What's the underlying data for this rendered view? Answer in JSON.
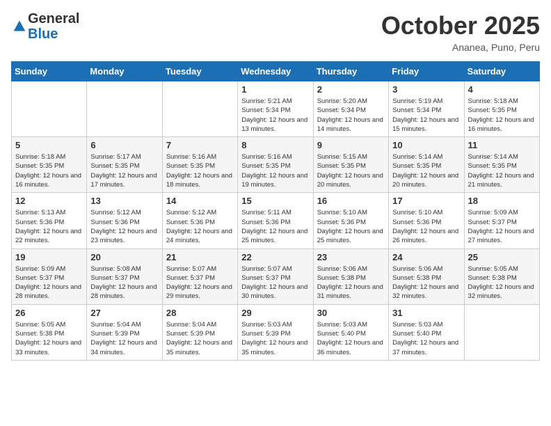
{
  "logo": {
    "general": "General",
    "blue": "Blue"
  },
  "header": {
    "month_title": "October 2025",
    "location": "Ananea, Puno, Peru"
  },
  "weekdays": [
    "Sunday",
    "Monday",
    "Tuesday",
    "Wednesday",
    "Thursday",
    "Friday",
    "Saturday"
  ],
  "weeks": [
    [
      {
        "day": "",
        "info": ""
      },
      {
        "day": "",
        "info": ""
      },
      {
        "day": "",
        "info": ""
      },
      {
        "day": "1",
        "info": "Sunrise: 5:21 AM\nSunset: 5:34 PM\nDaylight: 12 hours and 13 minutes."
      },
      {
        "day": "2",
        "info": "Sunrise: 5:20 AM\nSunset: 5:34 PM\nDaylight: 12 hours and 14 minutes."
      },
      {
        "day": "3",
        "info": "Sunrise: 5:19 AM\nSunset: 5:34 PM\nDaylight: 12 hours and 15 minutes."
      },
      {
        "day": "4",
        "info": "Sunrise: 5:18 AM\nSunset: 5:35 PM\nDaylight: 12 hours and 16 minutes."
      }
    ],
    [
      {
        "day": "5",
        "info": "Sunrise: 5:18 AM\nSunset: 5:35 PM\nDaylight: 12 hours and 16 minutes."
      },
      {
        "day": "6",
        "info": "Sunrise: 5:17 AM\nSunset: 5:35 PM\nDaylight: 12 hours and 17 minutes."
      },
      {
        "day": "7",
        "info": "Sunrise: 5:16 AM\nSunset: 5:35 PM\nDaylight: 12 hours and 18 minutes."
      },
      {
        "day": "8",
        "info": "Sunrise: 5:16 AM\nSunset: 5:35 PM\nDaylight: 12 hours and 19 minutes."
      },
      {
        "day": "9",
        "info": "Sunrise: 5:15 AM\nSunset: 5:35 PM\nDaylight: 12 hours and 20 minutes."
      },
      {
        "day": "10",
        "info": "Sunrise: 5:14 AM\nSunset: 5:35 PM\nDaylight: 12 hours and 20 minutes."
      },
      {
        "day": "11",
        "info": "Sunrise: 5:14 AM\nSunset: 5:35 PM\nDaylight: 12 hours and 21 minutes."
      }
    ],
    [
      {
        "day": "12",
        "info": "Sunrise: 5:13 AM\nSunset: 5:36 PM\nDaylight: 12 hours and 22 minutes."
      },
      {
        "day": "13",
        "info": "Sunrise: 5:12 AM\nSunset: 5:36 PM\nDaylight: 12 hours and 23 minutes."
      },
      {
        "day": "14",
        "info": "Sunrise: 5:12 AM\nSunset: 5:36 PM\nDaylight: 12 hours and 24 minutes."
      },
      {
        "day": "15",
        "info": "Sunrise: 5:11 AM\nSunset: 5:36 PM\nDaylight: 12 hours and 25 minutes."
      },
      {
        "day": "16",
        "info": "Sunrise: 5:10 AM\nSunset: 5:36 PM\nDaylight: 12 hours and 25 minutes."
      },
      {
        "day": "17",
        "info": "Sunrise: 5:10 AM\nSunset: 5:36 PM\nDaylight: 12 hours and 26 minutes."
      },
      {
        "day": "18",
        "info": "Sunrise: 5:09 AM\nSunset: 5:37 PM\nDaylight: 12 hours and 27 minutes."
      }
    ],
    [
      {
        "day": "19",
        "info": "Sunrise: 5:09 AM\nSunset: 5:37 PM\nDaylight: 12 hours and 28 minutes."
      },
      {
        "day": "20",
        "info": "Sunrise: 5:08 AM\nSunset: 5:37 PM\nDaylight: 12 hours and 28 minutes."
      },
      {
        "day": "21",
        "info": "Sunrise: 5:07 AM\nSunset: 5:37 PM\nDaylight: 12 hours and 29 minutes."
      },
      {
        "day": "22",
        "info": "Sunrise: 5:07 AM\nSunset: 5:37 PM\nDaylight: 12 hours and 30 minutes."
      },
      {
        "day": "23",
        "info": "Sunrise: 5:06 AM\nSunset: 5:38 PM\nDaylight: 12 hours and 31 minutes."
      },
      {
        "day": "24",
        "info": "Sunrise: 5:06 AM\nSunset: 5:38 PM\nDaylight: 12 hours and 32 minutes."
      },
      {
        "day": "25",
        "info": "Sunrise: 5:05 AM\nSunset: 5:38 PM\nDaylight: 12 hours and 32 minutes."
      }
    ],
    [
      {
        "day": "26",
        "info": "Sunrise: 5:05 AM\nSunset: 5:38 PM\nDaylight: 12 hours and 33 minutes."
      },
      {
        "day": "27",
        "info": "Sunrise: 5:04 AM\nSunset: 5:39 PM\nDaylight: 12 hours and 34 minutes."
      },
      {
        "day": "28",
        "info": "Sunrise: 5:04 AM\nSunset: 5:39 PM\nDaylight: 12 hours and 35 minutes."
      },
      {
        "day": "29",
        "info": "Sunrise: 5:03 AM\nSunset: 5:39 PM\nDaylight: 12 hours and 35 minutes."
      },
      {
        "day": "30",
        "info": "Sunrise: 5:03 AM\nSunset: 5:40 PM\nDaylight: 12 hours and 36 minutes."
      },
      {
        "day": "31",
        "info": "Sunrise: 5:03 AM\nSunset: 5:40 PM\nDaylight: 12 hours and 37 minutes."
      },
      {
        "day": "",
        "info": ""
      }
    ]
  ]
}
